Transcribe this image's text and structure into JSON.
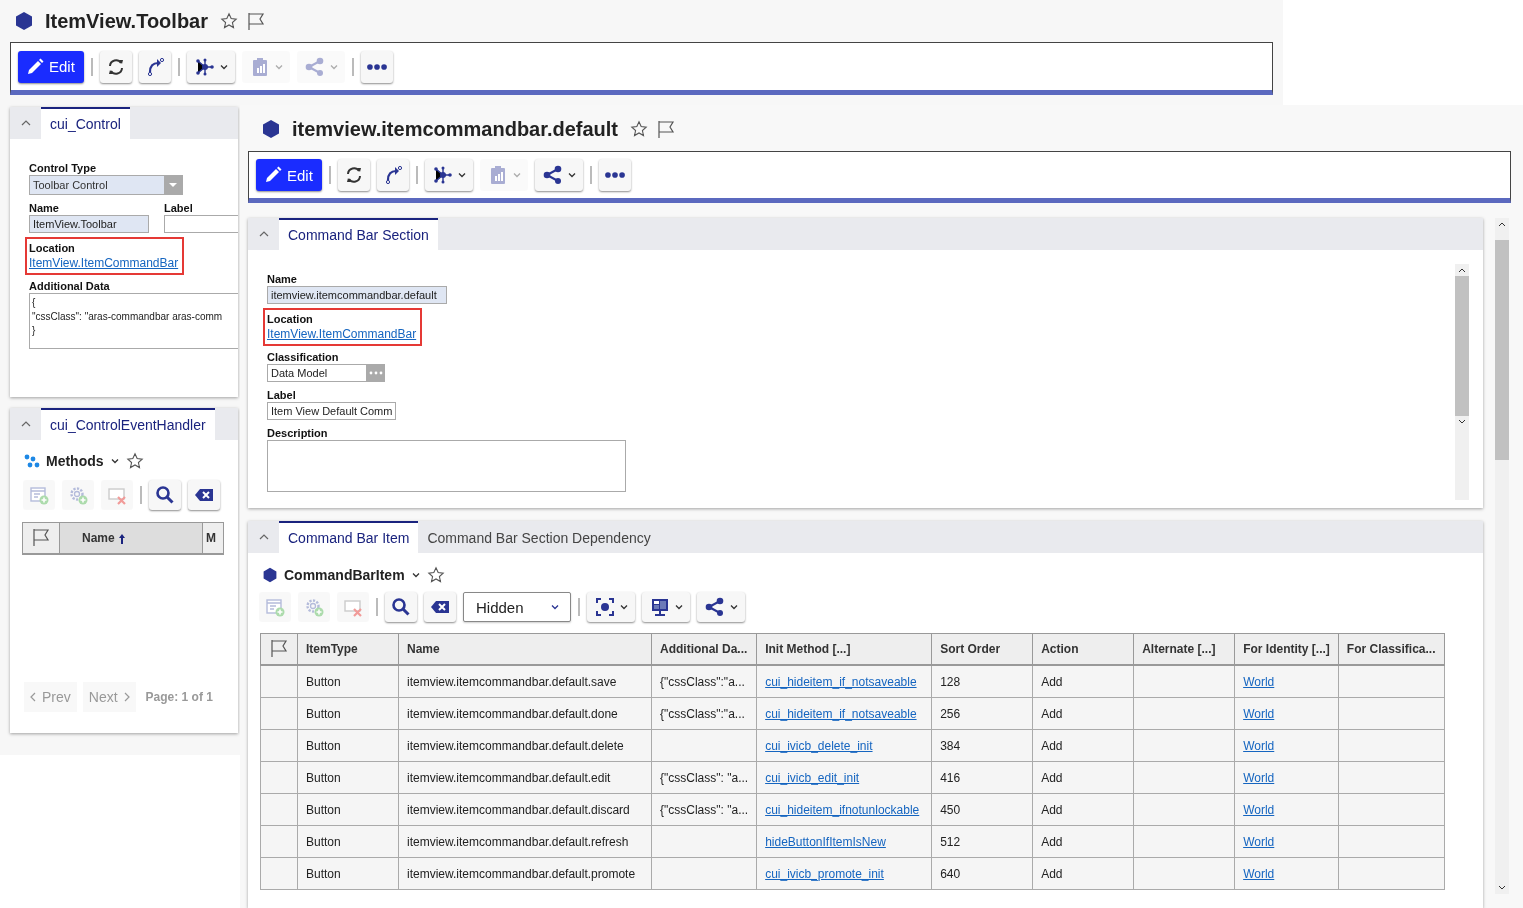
{
  "back_window": {
    "title": "ItemView.Toolbar",
    "toolbar": [
      {
        "kind": "edit",
        "label": "Edit",
        "disabled": false
      },
      {
        "kind": "separator"
      },
      {
        "kind": "refresh",
        "disabled": false
      },
      {
        "kind": "promote",
        "disabled": false
      },
      {
        "kind": "separator"
      },
      {
        "kind": "structure",
        "dropdown": true,
        "disabled": false
      },
      {
        "kind": "report",
        "dropdown": true,
        "disabled": true
      },
      {
        "kind": "share",
        "dropdown": true,
        "disabled": true
      },
      {
        "kind": "separator"
      },
      {
        "kind": "more",
        "disabled": false
      }
    ],
    "control_panel": {
      "tab": "cui_Control",
      "expanded": true,
      "rows": [
        [
          {
            "label": "Control Type",
            "kind": "select",
            "value": "Toolbar Control"
          }
        ],
        [
          {
            "label": "Name",
            "kind": "text",
            "value": "ItemView.Toolbar",
            "readonly": true
          },
          {
            "label": "Label",
            "kind": "text",
            "readonly": false
          }
        ],
        [
          {
            "label": "Location",
            "kind": "link",
            "value": "ItemView.ItemCommandBar",
            "highlighted": true
          }
        ],
        [
          {
            "label": "Additional Data",
            "kind": "textarea",
            "lines": [
              "{",
              "\"cssClass\": \"aras-commandbar aras-comm",
              "}"
            ]
          }
        ]
      ]
    },
    "event_handler_panel": {
      "tab": "cui_ControlEventHandler",
      "expanded": true,
      "search_title": "Methods",
      "toolbar": [
        {
          "kind": "new",
          "disabled": true
        },
        {
          "kind": "add",
          "disabled": true
        },
        {
          "kind": "delete",
          "disabled": true
        },
        {
          "kind": "separator"
        },
        {
          "kind": "search",
          "disabled": false
        },
        {
          "kind": "clear",
          "disabled": false
        }
      ],
      "columns": [
        {
          "kind": "flag"
        },
        {
          "kind": "text",
          "label": "Name",
          "sorted_ascending": true
        },
        {
          "kind": "text",
          "label": "M"
        }
      ],
      "pager": {
        "prev": {
          "label": "Prev",
          "disabled": true
        },
        "next": {
          "label": "Next",
          "disabled": true
        },
        "page": "Page: 1 of 1"
      }
    }
  },
  "front_window": {
    "title": "itemview.itemcommandbar.default",
    "toolbar": [
      {
        "kind": "edit",
        "label": "Edit",
        "disabled": false
      },
      {
        "kind": "separator"
      },
      {
        "kind": "refresh",
        "disabled": false
      },
      {
        "kind": "promote",
        "disabled": false
      },
      {
        "kind": "separator"
      },
      {
        "kind": "structure",
        "dropdown": true,
        "disabled": false
      },
      {
        "kind": "report",
        "dropdown": true,
        "disabled": true
      },
      {
        "kind": "share",
        "dropdown": true,
        "disabled": false
      },
      {
        "kind": "separator"
      },
      {
        "kind": "more",
        "disabled": false
      }
    ],
    "form_section": {
      "tab": "Command Bar Section",
      "expanded": true,
      "rows": [
        [
          {
            "label": "Name",
            "kind": "text",
            "value": "itemview.itemcommandbar.default",
            "readonly": true
          }
        ],
        [
          {
            "label": "Location",
            "kind": "link",
            "value": "ItemView.ItemCommandBar",
            "highlighted": true
          }
        ],
        [
          {
            "label": "Classification",
            "kind": "item",
            "value": "Data Model"
          }
        ],
        [
          {
            "label": "Label",
            "kind": "text",
            "value": "Item View Default Comm",
            "readonly": false
          }
        ],
        [
          {
            "label": "Description",
            "kind": "textarea"
          }
        ]
      ]
    },
    "relationships": {
      "expanded": true,
      "tabs": [
        {
          "label": "Command Bar Item",
          "selected": true
        },
        {
          "label": "Command Bar Section Dependency",
          "selected": false
        }
      ],
      "grid_title": "CommandBarItem",
      "toolbar": [
        {
          "kind": "new",
          "disabled": true
        },
        {
          "kind": "add",
          "disabled": true
        },
        {
          "kind": "delete",
          "disabled": true
        },
        {
          "kind": "separator"
        },
        {
          "kind": "search",
          "disabled": false
        },
        {
          "kind": "clear",
          "disabled": false
        },
        {
          "kind": "select",
          "value": "Hidden"
        },
        {
          "kind": "separator"
        },
        {
          "kind": "view",
          "dropdown": true,
          "disabled": false
        },
        {
          "kind": "display",
          "dropdown": true,
          "disabled": false
        },
        {
          "kind": "share",
          "dropdown": true,
          "disabled": false
        }
      ],
      "columns": [
        {
          "kind": "flag"
        },
        {
          "kind": "text",
          "label": "ItemType"
        },
        {
          "kind": "text",
          "label": "Name"
        },
        {
          "kind": "text",
          "label": "Additional Da..."
        },
        {
          "kind": "link",
          "label": "Init Method [...]"
        },
        {
          "kind": "text",
          "label": "Sort Order"
        },
        {
          "kind": "text",
          "label": "Action"
        },
        {
          "kind": "text",
          "label": "Alternate [...]"
        },
        {
          "kind": "link",
          "label": "For Identity [...]"
        },
        {
          "kind": "text",
          "label": "For Classifica..."
        }
      ],
      "rows": [
        [
          null,
          "Button",
          "itemview.itemcommandbar.default.save",
          "{\"cssClass\":\"a...",
          "cui_hideitem_if_notsaveable",
          "128",
          "Add",
          null,
          "World",
          null
        ],
        [
          null,
          "Button",
          "itemview.itemcommandbar.default.done",
          "{\"cssClass\":\"a...",
          "cui_hideitem_if_notsaveable",
          "256",
          "Add",
          null,
          "World",
          null
        ],
        [
          null,
          "Button",
          "itemview.itemcommandbar.default.delete",
          null,
          "cui_ivicb_delete_init",
          "384",
          "Add",
          null,
          "World",
          null
        ],
        [
          null,
          "Button",
          "itemview.itemcommandbar.default.edit",
          "{\"cssClass\": \"a...",
          "cui_ivicb_edit_init",
          "416",
          "Add",
          null,
          "World",
          null
        ],
        [
          null,
          "Button",
          "itemview.itemcommandbar.default.discard",
          "{\"cssClass\": \"a...",
          "cui_hideitem_ifnotunlockable",
          "450",
          "Add",
          null,
          "World",
          null
        ],
        [
          null,
          "Button",
          "itemview.itemcommandbar.default.refresh",
          null,
          "hideButtonIfItemIsNew",
          "512",
          "Add",
          null,
          "World",
          null
        ],
        [
          null,
          "Button",
          "itemview.itemcommandbar.default.promote",
          null,
          "cui_ivicb_promote_init",
          "640",
          "Add",
          null,
          "World",
          null
        ]
      ]
    }
  }
}
